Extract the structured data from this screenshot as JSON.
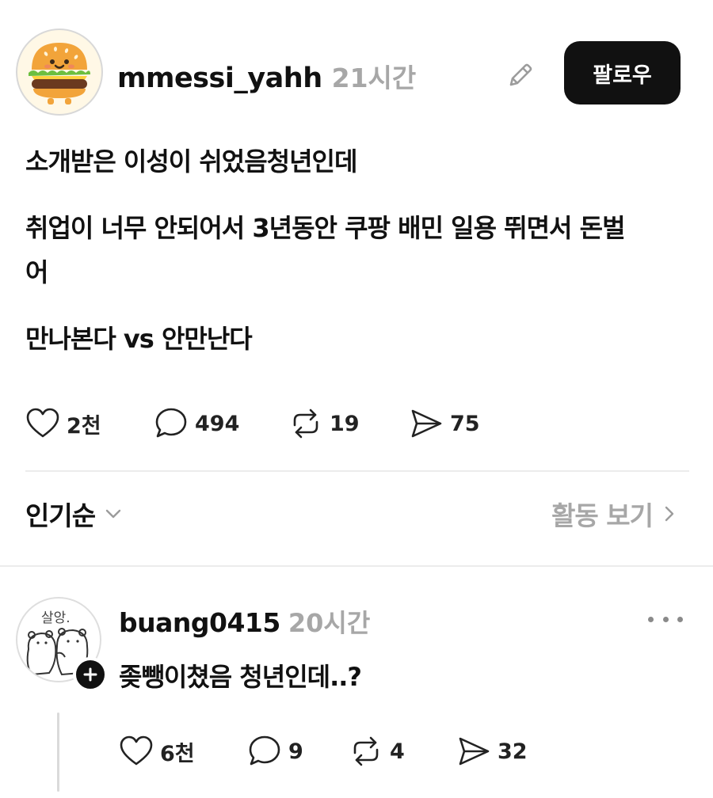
{
  "post": {
    "username": "mmessi_yahh",
    "time": "21시간",
    "follow_label": "팔로우",
    "paragraphs": [
      "소개받은 이성이 쉬었음청년인데",
      "취업이 너무 안되어서 3년동안 쿠팡 배민 일용 뛰면서 돈벌어",
      "만나본다 vs 안만난다"
    ],
    "stats": {
      "likes": "2천",
      "comments": "494",
      "reposts": "19",
      "shares": "75"
    }
  },
  "sort": {
    "label": "인기순",
    "activity_label": "활동 보기"
  },
  "reply": {
    "avatar_text": "살앙.",
    "username": "buang0415",
    "time": "20시간",
    "text": "좆뺑이쳤음 청년인데..?",
    "stats": {
      "likes": "6천",
      "comments": "9",
      "reposts": "4",
      "shares": "32"
    }
  },
  "icons": {
    "post_avatar": "burger-avatar-icon",
    "edit": "pencil-icon",
    "like": "heart-icon",
    "comment": "comment-bubble-icon",
    "repost": "repost-icon",
    "share": "send-icon",
    "sort_chevron": "chevron-down-icon",
    "activity_chevron": "chevron-right-icon",
    "more": "more-dots-icon",
    "add": "plus-icon"
  },
  "colors": {
    "text": "#111111",
    "muted": "#a7a7a7",
    "follow_bg": "#111111",
    "divider": "#ececec"
  }
}
